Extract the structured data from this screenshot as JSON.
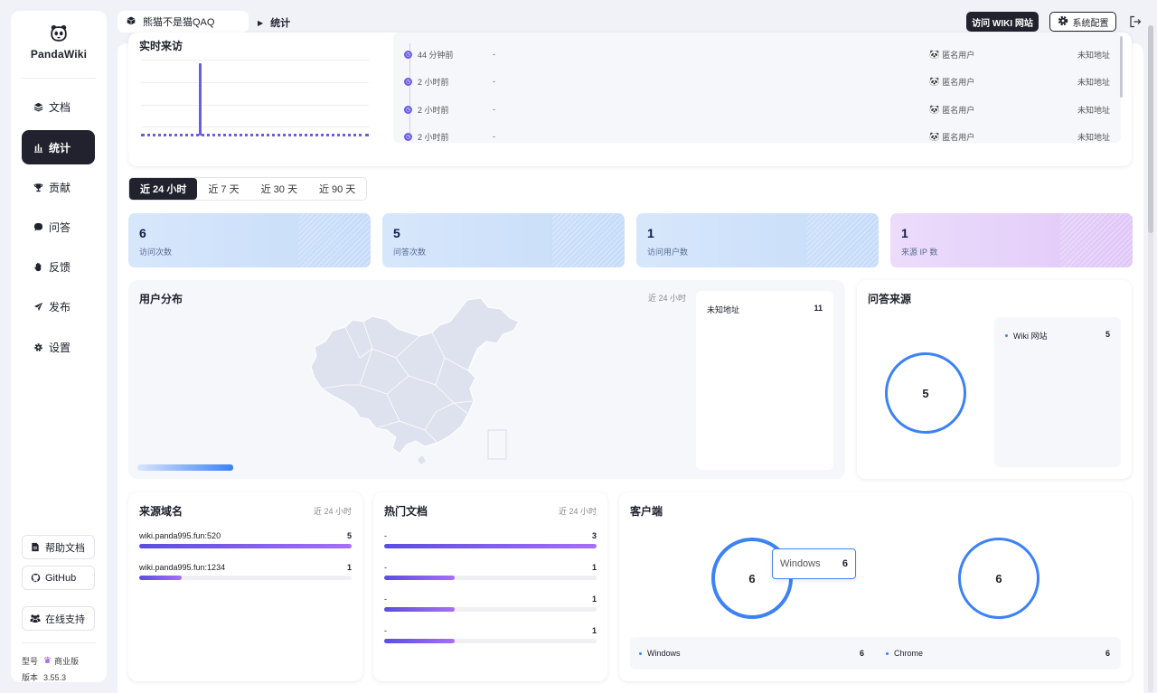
{
  "app": {
    "name": "PandaWiki"
  },
  "sidebar": {
    "nav": [
      {
        "label": "文档",
        "icon": "layers-icon"
      },
      {
        "label": "统计",
        "icon": "bar-chart-icon"
      },
      {
        "label": "贡献",
        "icon": "trophy-icon"
      },
      {
        "label": "问答",
        "icon": "chat-icon"
      },
      {
        "label": "反馈",
        "icon": "hand-icon"
      },
      {
        "label": "发布",
        "icon": "send-icon"
      },
      {
        "label": "设置",
        "icon": "gear-icon"
      }
    ],
    "active": "统计",
    "help_label": "帮助文档",
    "github_label": "GitHub",
    "support_label": "在线支持",
    "model_key": "型号",
    "model_value": "商业版",
    "version_key": "版本",
    "version_value": "3.55.3"
  },
  "header": {
    "kb_name": "熊猫不是猫QAQ",
    "breadcrumb": "统计",
    "visit_label": "访问 WIKI 网站",
    "config_label": "系统配置"
  },
  "realtime": {
    "title": "实时来访",
    "entries": [
      {
        "time": "44 分钟前",
        "page": "-",
        "user": "匿名用户",
        "addr": "未知地址"
      },
      {
        "time": "2 小时前",
        "page": "-",
        "user": "匿名用户",
        "addr": "未知地址"
      },
      {
        "time": "2 小时前",
        "page": "-",
        "user": "匿名用户",
        "addr": "未知地址"
      },
      {
        "time": "2 小时前",
        "page": "-",
        "user": "匿名用户",
        "addr": "未知地址"
      }
    ]
  },
  "tabs": [
    "近 24 小时",
    "近 7 天",
    "近 30 天",
    "近 90 天"
  ],
  "active_tab": "近 24 小时",
  "stats": [
    {
      "value": "6",
      "label": "访问次数"
    },
    {
      "value": "5",
      "label": "问答次数"
    },
    {
      "value": "1",
      "label": "访问用户数"
    },
    {
      "value": "1",
      "label": "来源 IP 数"
    }
  ],
  "user_dist": {
    "title": "用户分布",
    "range": "近 24 小时",
    "locations": [
      {
        "name": "未知地址",
        "value": "11"
      }
    ]
  },
  "qa_source": {
    "title": "问答来源",
    "total": "5",
    "items": [
      {
        "name": "Wiki 网站",
        "value": "5"
      }
    ]
  },
  "referrer": {
    "title": "来源域名",
    "range": "近 24 小时",
    "items": [
      {
        "name": "wiki.panda995.fun:520",
        "value": "5",
        "ratio": 1.0
      },
      {
        "name": "wiki.panda995.fun:1234",
        "value": "1",
        "ratio": 0.2
      }
    ]
  },
  "hot_docs": {
    "title": "热门文档",
    "range": "近 24 小时",
    "items": [
      {
        "name": "-",
        "value": "3",
        "ratio": 1.0
      },
      {
        "name": "-",
        "value": "1",
        "ratio": 0.33
      },
      {
        "name": "-",
        "value": "1",
        "ratio": 0.33
      },
      {
        "name": "-",
        "value": "1",
        "ratio": 0.33
      }
    ]
  },
  "client": {
    "title": "客户端",
    "os_total": "6",
    "browser_total": "6",
    "tooltip": {
      "name": "Windows",
      "value": "6"
    },
    "os": [
      {
        "name": "Windows",
        "value": "6"
      }
    ],
    "browser": [
      {
        "name": "Chrome",
        "value": "6"
      }
    ]
  },
  "colors": {
    "accent": "#3b82f6",
    "dark": "#21222d",
    "bar_start": "#5b4de2",
    "bar_end": "#a76ff5"
  }
}
